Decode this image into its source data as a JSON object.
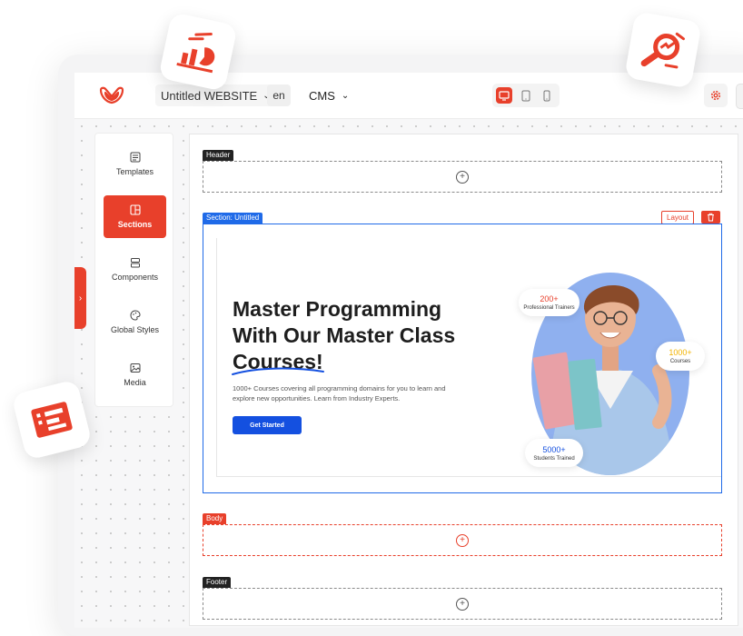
{
  "colors": {
    "accent": "#e8402b",
    "primary_blue": "#1450e0",
    "selection_blue": "#1f6ae8"
  },
  "topbar": {
    "site_name": "Untitled WEBSITE",
    "language": "en",
    "cms_label": "CMS",
    "devices": [
      "desktop-icon",
      "tablet-icon",
      "mobile-icon"
    ],
    "active_device": "desktop"
  },
  "sidebar": {
    "items": [
      {
        "label": "Templates",
        "icon": "templates-icon"
      },
      {
        "label": "Sections",
        "icon": "sections-icon",
        "active": true
      },
      {
        "label": "Components",
        "icon": "components-icon"
      },
      {
        "label": "Global Styles",
        "icon": "palette-icon"
      },
      {
        "label": "Media",
        "icon": "image-icon"
      }
    ]
  },
  "editor": {
    "header_tag": "Header",
    "section_tag": "Section: Untitled",
    "layout_button": "Layout",
    "body_tag": "Body",
    "footer_tag": "Footer"
  },
  "hero": {
    "title_line1": "Master Programming",
    "title_line2": "With Our Master Class",
    "title_line3": "Courses!",
    "description": "1000+ Courses covering all programming domains for you to learn and explore new opportunities. Learn from Industry Experts.",
    "cta_label": "Get Started",
    "stats": [
      {
        "number": "200+",
        "label": "Professional Trainers",
        "color": "#e8402b"
      },
      {
        "number": "1000+",
        "label": "Courses",
        "color": "#f2b300"
      },
      {
        "number": "5000+",
        "label": "Students Trained",
        "color": "#1450e0"
      }
    ]
  }
}
